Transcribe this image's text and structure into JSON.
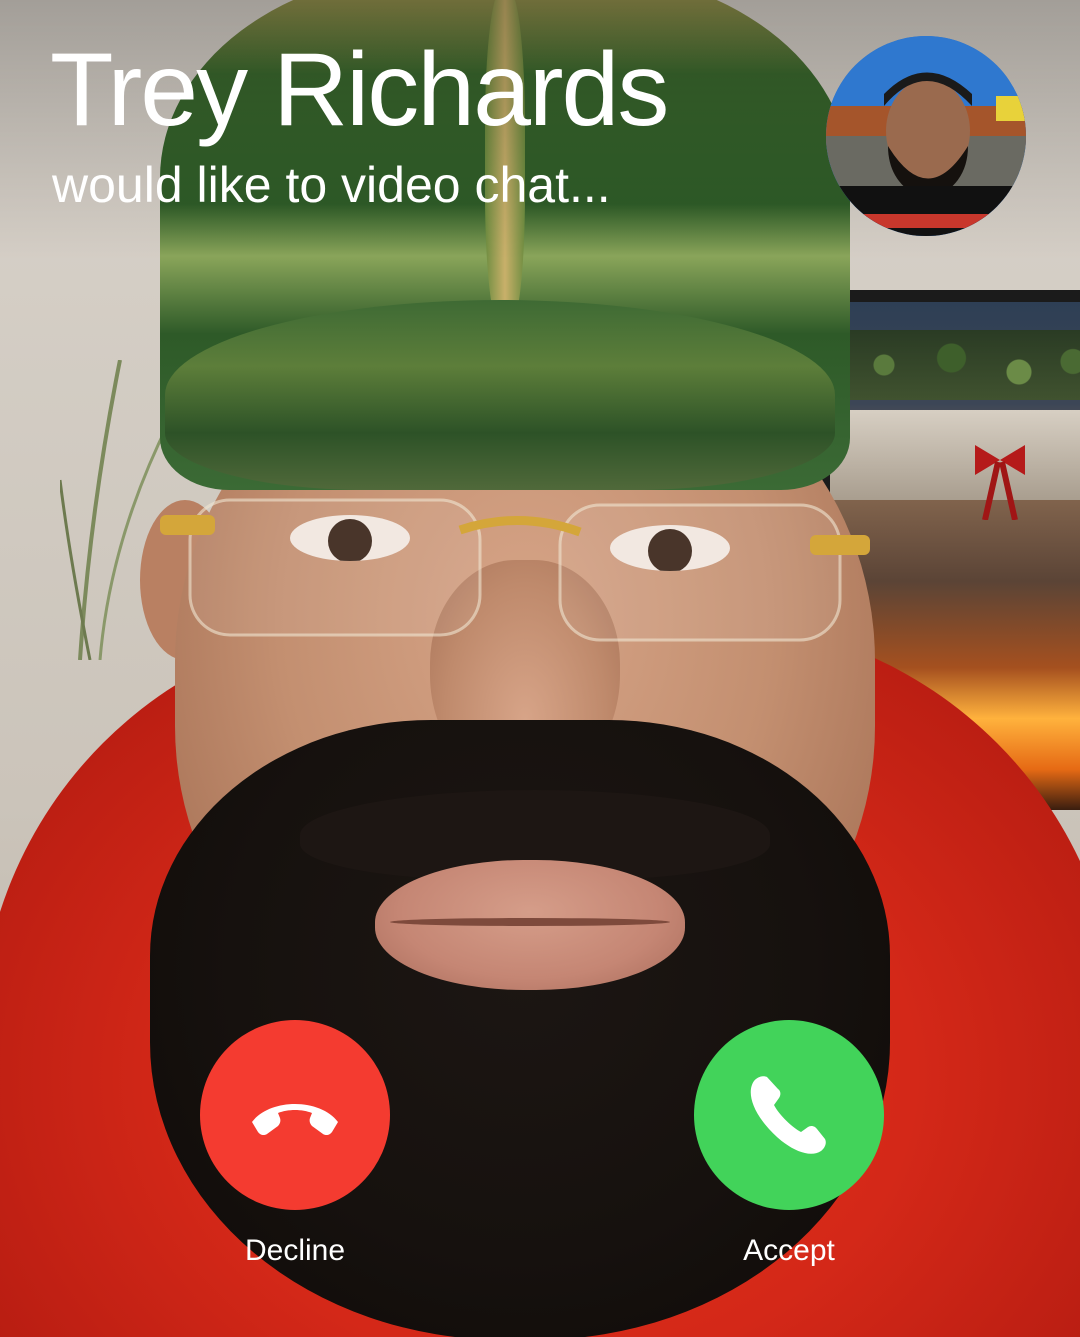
{
  "caller": {
    "name": "Trey Richards",
    "subtitle": "would like to video chat..."
  },
  "self_view": {
    "description_icon": "self-preview-avatar"
  },
  "actions": {
    "decline_label": "Decline",
    "accept_label": "Accept",
    "decline_icon": "phone-hangup-icon",
    "accept_icon": "phone-icon",
    "decline_color": "#f43b30",
    "accept_color": "#42d35a"
  }
}
